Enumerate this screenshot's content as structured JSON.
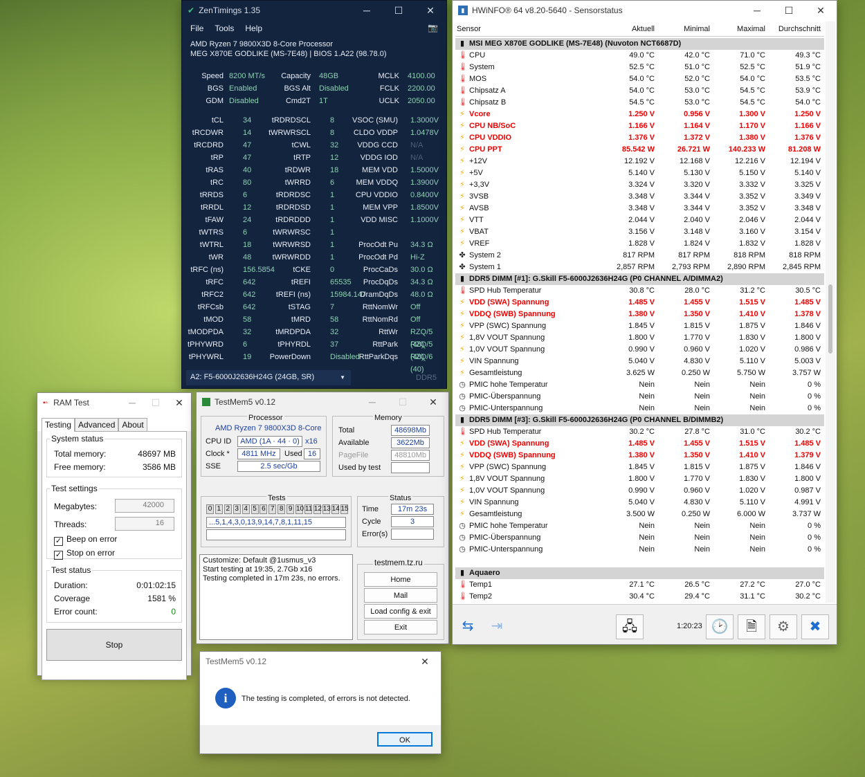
{
  "zen": {
    "title": "ZenTimings 1.35",
    "menu": [
      "File",
      "Tools",
      "Help"
    ],
    "cpu": "AMD Ryzen 7 9800X3D 8-Core Processor",
    "board": "MEG X870E GODLIKE (MS-7E48) | BIOS 1.A22 (98.78.0)",
    "top": [
      [
        "Speed",
        "8200 MT/s",
        "Capacity",
        "48GB",
        "MCLK",
        "4100.00"
      ],
      [
        "BGS",
        "Enabled",
        "BGS Alt",
        "Disabled",
        "FCLK",
        "2200.00"
      ],
      [
        "GDM",
        "Disabled",
        "Cmd2T",
        "1T",
        "UCLK",
        "2050.00"
      ]
    ],
    "rows": [
      [
        "tCL",
        "34",
        "tRDRDSCL",
        "8",
        "VSOC (SMU)",
        "1.3000V"
      ],
      [
        "tRCDWR",
        "14",
        "tWRWRSCL",
        "8",
        "CLDO VDDP",
        "1.0478V"
      ],
      [
        "tRCDRD",
        "47",
        "tCWL",
        "32",
        "VDDG CCD",
        "N/A"
      ],
      [
        "tRP",
        "47",
        "tRTP",
        "12",
        "VDDG IOD",
        "N/A"
      ],
      [
        "tRAS",
        "40",
        "tRDWR",
        "18",
        "MEM VDD",
        "1.5000V"
      ],
      [
        "tRC",
        "80",
        "tWRRD",
        "6",
        "MEM VDDQ",
        "1.3900V"
      ],
      [
        "tRRDS",
        "6",
        "tRDRDSC",
        "1",
        "CPU VDDIO",
        "0.8400V"
      ],
      [
        "tRRDL",
        "12",
        "tRDRDSD",
        "1",
        "MEM VPP",
        "1.8500V"
      ],
      [
        "tFAW",
        "24",
        "tRDRDDD",
        "1",
        "VDD MISC",
        "1.1000V"
      ],
      [
        "tWTRS",
        "6",
        "tWRWRSC",
        "1",
        "",
        ""
      ],
      [
        "tWTRL",
        "18",
        "tWRWRSD",
        "1",
        "ProcOdt Pu",
        "34.3 Ω"
      ],
      [
        "tWR",
        "48",
        "tWRWRDD",
        "1",
        "ProcOdt Pd",
        "Hi-Z"
      ],
      [
        "tRFC (ns)",
        "156.5854",
        "tCKE",
        "0",
        "ProcCaDs",
        "30.0 Ω"
      ],
      [
        "tRFC",
        "642",
        "tREFI",
        "65535",
        "ProcDqDs",
        "34.3 Ω"
      ],
      [
        "tRFC2",
        "642",
        "tREFI (ns)",
        "15984.147",
        "DramDqDs",
        "48.0 Ω"
      ],
      [
        "tRFCsb",
        "642",
        "tSTAG",
        "7",
        "RttNomWr",
        "Off"
      ],
      [
        "tMOD",
        "58",
        "tMRD",
        "58",
        "RttNomRd",
        "Off"
      ],
      [
        "tMODPDA",
        "32",
        "tMRDPDA",
        "32",
        "RttWr",
        "RZQ/5 (48)"
      ],
      [
        "tPHYWRD",
        "6",
        "tPHYRDL",
        "37",
        "RttPark",
        "RZQ/5 (48)"
      ],
      [
        "tPHYWRL",
        "19",
        "PowerDown",
        "Disabled",
        "RttParkDqs",
        "RZQ/6 (40)"
      ]
    ],
    "dimm": "A2: F5-6000J2636H24G (24GB, SR)",
    "ddr": "DDR5"
  },
  "ram": {
    "title": "RAM Test",
    "tabs": [
      "Testing",
      "Advanced",
      "About"
    ],
    "sys_status": "System status",
    "total_lbl": "Total memory:",
    "total": "48697 MB",
    "free_lbl": "Free memory:",
    "free": "3586 MB",
    "settings": "Test settings",
    "mb_lbl": "Megabytes:",
    "mb": "42000",
    "threads_lbl": "Threads:",
    "threads": "16",
    "beep": "Beep on error",
    "stop_err": "Stop on error",
    "test_status": "Test status",
    "dur_lbl": "Duration:",
    "dur": "0:01:02:15",
    "cov_lbl": "Coverage",
    "cov": "1581 %",
    "err_lbl": "Error count:",
    "err": "0",
    "stop": "Stop"
  },
  "tm5": {
    "title": "TestMem5 v0.12",
    "proc_lbl": "Processor",
    "proc": "AMD Ryzen 7 9800X3D 8-Core",
    "cpuid_lbl": "CPU ID",
    "cpuid": "AMD  (1A · 44 · 0)",
    "x": "x16",
    "clock_lbl": "Clock *",
    "clock": "4811 MHz",
    "used_lbl": "Used",
    "used": "16",
    "sse_lbl": "SSE",
    "sse": "2.5 sec/Gb",
    "mem_lbl": "Memory",
    "total_lbl": "Total",
    "total": "48698Mb",
    "avail_lbl": "Available",
    "avail": "3622Mb",
    "pf_lbl": "PageFile",
    "pf": "48810Mb",
    "ubt_lbl": "Used by test",
    "tests_lbl": "Tests",
    "tests": [
      "0",
      "1",
      "2",
      "3",
      "4",
      "5",
      "6",
      "7",
      "8",
      "9",
      "10",
      "11",
      "12",
      "13",
      "14",
      "15"
    ],
    "seq": "...5,1,4,3,0,13,9,14,7,8,1,11,15",
    "status_lbl": "Status",
    "time_lbl": "Time",
    "time": "17m 23s",
    "cycle_lbl": "Cycle",
    "cycle": "3",
    "errs_lbl": "Error(s)",
    "log": [
      "Customize: Default @1usmus_v3",
      "Start testing at 19:35, 2.7Gb x16",
      "Testing completed in 17m 23s, no errors."
    ],
    "site": "testmem.tz.ru",
    "home": "Home",
    "mail": "Mail",
    "load": "Load config & exit",
    "exit": "Exit"
  },
  "dlg": {
    "title": "TestMem5 v0.12",
    "msg": "The testing is completed, of errors is not detected.",
    "ok": "OK"
  },
  "hw": {
    "title": "HWiNFO® 64 v8.20-5640 - Sensorstatus",
    "cols": [
      "Sensor",
      "Aktuell",
      "Minimal",
      "Maximal",
      "Durchschnitt"
    ],
    "rows": [
      {
        "t": "sec",
        "n": "MSI MEG X870E GODLIKE (MS-7E48) (Nuvoton NCT6687D)"
      },
      {
        "t": "th",
        "n": "CPU",
        "v": [
          "49.0 °C",
          "42.0 °C",
          "71.0 °C",
          "49.3 °C"
        ]
      },
      {
        "t": "th",
        "n": "System",
        "v": [
          "52.5 °C",
          "51.0 °C",
          "52.5 °C",
          "51.9 °C"
        ]
      },
      {
        "t": "th",
        "n": "MOS",
        "v": [
          "54.0 °C",
          "52.0 °C",
          "54.0 °C",
          "53.5 °C"
        ]
      },
      {
        "t": "th",
        "n": "Chipsatz A",
        "v": [
          "54.0 °C",
          "53.0 °C",
          "54.5 °C",
          "53.9 °C"
        ]
      },
      {
        "t": "th",
        "n": "Chipsatz B",
        "v": [
          "54.5 °C",
          "53.0 °C",
          "54.5 °C",
          "54.0 °C"
        ]
      },
      {
        "t": "vo",
        "r": 1,
        "n": "Vcore",
        "v": [
          "1.250 V",
          "0.956 V",
          "1.300 V",
          "1.250 V"
        ]
      },
      {
        "t": "vo",
        "r": 1,
        "n": "CPU NB/SoC",
        "v": [
          "1.166 V",
          "1.164 V",
          "1.170 V",
          "1.166 V"
        ]
      },
      {
        "t": "vo",
        "r": 1,
        "n": "CPU VDDIO",
        "v": [
          "1.376 V",
          "1.372 V",
          "1.380 V",
          "1.376 V"
        ]
      },
      {
        "t": "vo",
        "r": 1,
        "n": "CPU PPT",
        "v": [
          "85.542 W",
          "26.721 W",
          "140.233 W",
          "81.208 W"
        ]
      },
      {
        "t": "vo",
        "n": "+12V",
        "v": [
          "12.192 V",
          "12.168 V",
          "12.216 V",
          "12.194 V"
        ]
      },
      {
        "t": "vo",
        "n": "+5V",
        "v": [
          "5.140 V",
          "5.130 V",
          "5.150 V",
          "5.140 V"
        ]
      },
      {
        "t": "vo",
        "n": "+3,3V",
        "v": [
          "3.324 V",
          "3.320 V",
          "3.332 V",
          "3.325 V"
        ]
      },
      {
        "t": "vo",
        "n": "3VSB",
        "v": [
          "3.348 V",
          "3.344 V",
          "3.352 V",
          "3.349 V"
        ]
      },
      {
        "t": "vo",
        "n": "AVSB",
        "v": [
          "3.348 V",
          "3.344 V",
          "3.352 V",
          "3.348 V"
        ]
      },
      {
        "t": "vo",
        "n": "VTT",
        "v": [
          "2.044 V",
          "2.040 V",
          "2.046 V",
          "2.044 V"
        ]
      },
      {
        "t": "vo",
        "n": "VBAT",
        "v": [
          "3.156 V",
          "3.148 V",
          "3.160 V",
          "3.154 V"
        ]
      },
      {
        "t": "vo",
        "n": "VREF",
        "v": [
          "1.828 V",
          "1.824 V",
          "1.832 V",
          "1.828 V"
        ]
      },
      {
        "t": "fan",
        "n": "System 2",
        "v": [
          "817 RPM",
          "817 RPM",
          "818 RPM",
          "818 RPM"
        ]
      },
      {
        "t": "fan",
        "n": "System 1",
        "v": [
          "2,857 RPM",
          "2,793 RPM",
          "2,890 RPM",
          "2,845 RPM"
        ]
      },
      {
        "t": "sec",
        "n": "DDR5 DIMM [#1]: G.Skill F5-6000J2636H24G (P0 CHANNEL A/DIMMA2)"
      },
      {
        "t": "th",
        "n": "SPD Hub Temperatur",
        "v": [
          "30.8 °C",
          "28.0 °C",
          "31.2 °C",
          "30.5 °C"
        ]
      },
      {
        "t": "vo",
        "r": 1,
        "n": "VDD (SWA) Spannung",
        "v": [
          "1.485 V",
          "1.455 V",
          "1.515 V",
          "1.485 V"
        ]
      },
      {
        "t": "vo",
        "r": 1,
        "n": "VDDQ (SWB) Spannung",
        "v": [
          "1.380 V",
          "1.350 V",
          "1.410 V",
          "1.378 V"
        ]
      },
      {
        "t": "vo",
        "n": "VPP (SWC) Spannung",
        "v": [
          "1.845 V",
          "1.815 V",
          "1.875 V",
          "1.846 V"
        ]
      },
      {
        "t": "vo",
        "n": "1,8V VOUT Spannung",
        "v": [
          "1.800 V",
          "1.770 V",
          "1.830 V",
          "1.800 V"
        ]
      },
      {
        "t": "vo",
        "n": "1,0V VOUT Spannung",
        "v": [
          "0.990 V",
          "0.960 V",
          "1.020 V",
          "0.986 V"
        ]
      },
      {
        "t": "vo",
        "n": "VIN Spannung",
        "v": [
          "5.040 V",
          "4.830 V",
          "5.110 V",
          "5.003 V"
        ]
      },
      {
        "t": "vo",
        "n": "Gesamtleistung",
        "v": [
          "3.625 W",
          "0.250 W",
          "5.750 W",
          "3.757 W"
        ]
      },
      {
        "t": "cl",
        "n": "PMIC hohe Temperatur",
        "v": [
          "Nein",
          "Nein",
          "Nein",
          "0 %"
        ]
      },
      {
        "t": "cl",
        "n": "PMIC-Überspannung",
        "v": [
          "Nein",
          "Nein",
          "Nein",
          "0 %"
        ]
      },
      {
        "t": "cl",
        "n": "PMIC-Unterspannung",
        "v": [
          "Nein",
          "Nein",
          "Nein",
          "0 %"
        ]
      },
      {
        "t": "sec",
        "n": "DDR5 DIMM [#3]: G.Skill F5-6000J2636H24G (P0 CHANNEL B/DIMMB2)"
      },
      {
        "t": "th",
        "n": "SPD Hub Temperatur",
        "v": [
          "30.2 °C",
          "27.8 °C",
          "31.0 °C",
          "30.2 °C"
        ]
      },
      {
        "t": "vo",
        "r": 1,
        "n": "VDD (SWA) Spannung",
        "v": [
          "1.485 V",
          "1.455 V",
          "1.515 V",
          "1.485 V"
        ]
      },
      {
        "t": "vo",
        "r": 1,
        "n": "VDDQ (SWB) Spannung",
        "v": [
          "1.380 V",
          "1.350 V",
          "1.410 V",
          "1.379 V"
        ]
      },
      {
        "t": "vo",
        "n": "VPP (SWC) Spannung",
        "v": [
          "1.845 V",
          "1.815 V",
          "1.875 V",
          "1.846 V"
        ]
      },
      {
        "t": "vo",
        "n": "1,8V VOUT Spannung",
        "v": [
          "1.800 V",
          "1.770 V",
          "1.830 V",
          "1.800 V"
        ]
      },
      {
        "t": "vo",
        "n": "1,0V VOUT Spannung",
        "v": [
          "0.990 V",
          "0.960 V",
          "1.020 V",
          "0.987 V"
        ]
      },
      {
        "t": "vo",
        "n": "VIN Spannung",
        "v": [
          "5.040 V",
          "4.830 V",
          "5.110 V",
          "4.991 V"
        ]
      },
      {
        "t": "vo",
        "n": "Gesamtleistung",
        "v": [
          "3.500 W",
          "0.250 W",
          "6.000 W",
          "3.737 W"
        ]
      },
      {
        "t": "cl",
        "n": "PMIC hohe Temperatur",
        "v": [
          "Nein",
          "Nein",
          "Nein",
          "0 %"
        ]
      },
      {
        "t": "cl",
        "n": "PMIC-Überspannung",
        "v": [
          "Nein",
          "Nein",
          "Nein",
          "0 %"
        ]
      },
      {
        "t": "cl",
        "n": "PMIC-Unterspannung",
        "v": [
          "Nein",
          "Nein",
          "Nein",
          "0 %"
        ]
      },
      {
        "t": "blank",
        "n": ""
      },
      {
        "t": "sec",
        "n": "Aquaero"
      },
      {
        "t": "th",
        "n": "Temp1",
        "v": [
          "27.1 °C",
          "26.5 °C",
          "27.2 °C",
          "27.0 °C"
        ]
      },
      {
        "t": "th",
        "n": "Temp2",
        "v": [
          "30.4 °C",
          "29.4 °C",
          "31.1 °C",
          "30.2 °C"
        ]
      }
    ],
    "timer": "1:20:23"
  }
}
